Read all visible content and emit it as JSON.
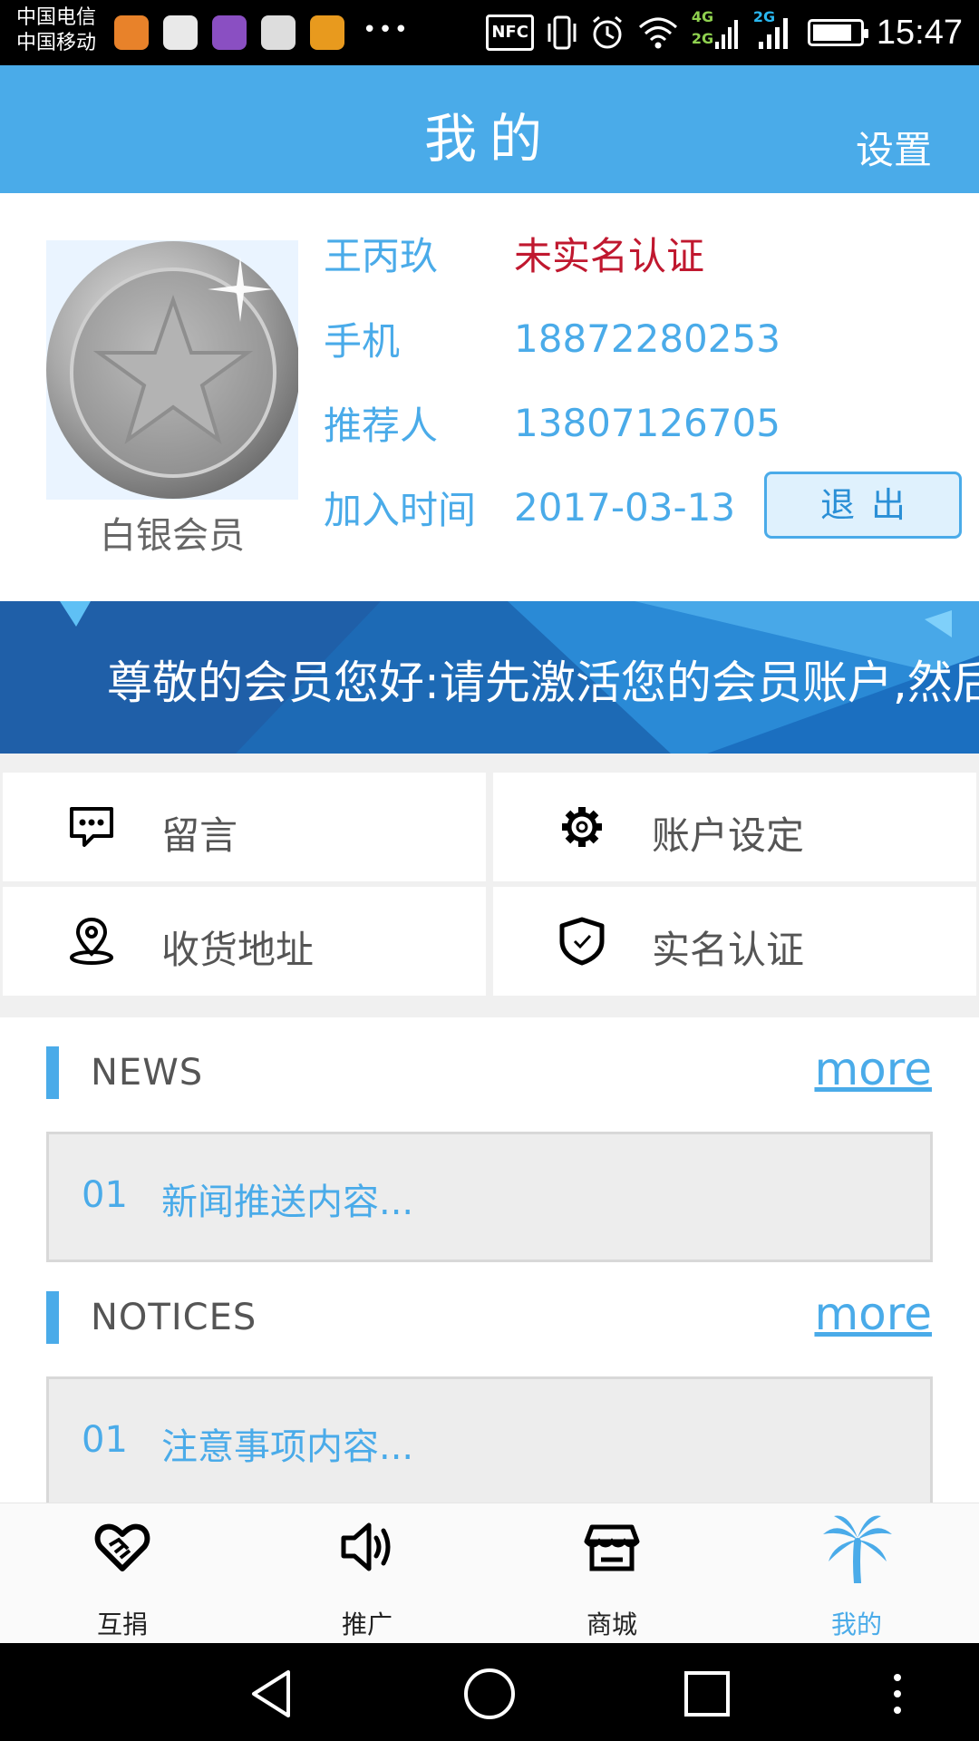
{
  "status_bar": {
    "carrier_1": "中国电信",
    "carrier_2": "中国移动",
    "nfc": "NFC",
    "net_1": "4G",
    "net_2": "2G",
    "net_3": "2G",
    "time": "15:47"
  },
  "header": {
    "title": "我的",
    "settings": "设置"
  },
  "profile": {
    "level": "白银会员",
    "name": "王丙玖",
    "verify_status": "未实名认证",
    "phone_label": "手机",
    "phone": "18872280253",
    "referrer_label": "推荐人",
    "referrer": "13807126705",
    "join_label": "加入时间",
    "join_date": "2017-03-13",
    "logout": "退出"
  },
  "banner": {
    "text": "尊敬的会员您好:请先激活您的会员账户,然后"
  },
  "menu": {
    "message": "留言",
    "account_settings": "账户设定",
    "address": "收货地址",
    "real_name": "实名认证"
  },
  "news": {
    "title": "NEWS",
    "more": "more",
    "item_no": "01",
    "item_text": "新闻推送内容..."
  },
  "notices": {
    "title": "NOTICES",
    "more": "more",
    "item_no": "01",
    "item_text": "注意事项内容..."
  },
  "tabs": {
    "donate": "互捐",
    "promote": "推广",
    "mall": "商城",
    "mine": "我的"
  },
  "colors": {
    "primary": "#4aabe9",
    "warning": "#c0182f",
    "banner": "#1d6ab5"
  }
}
